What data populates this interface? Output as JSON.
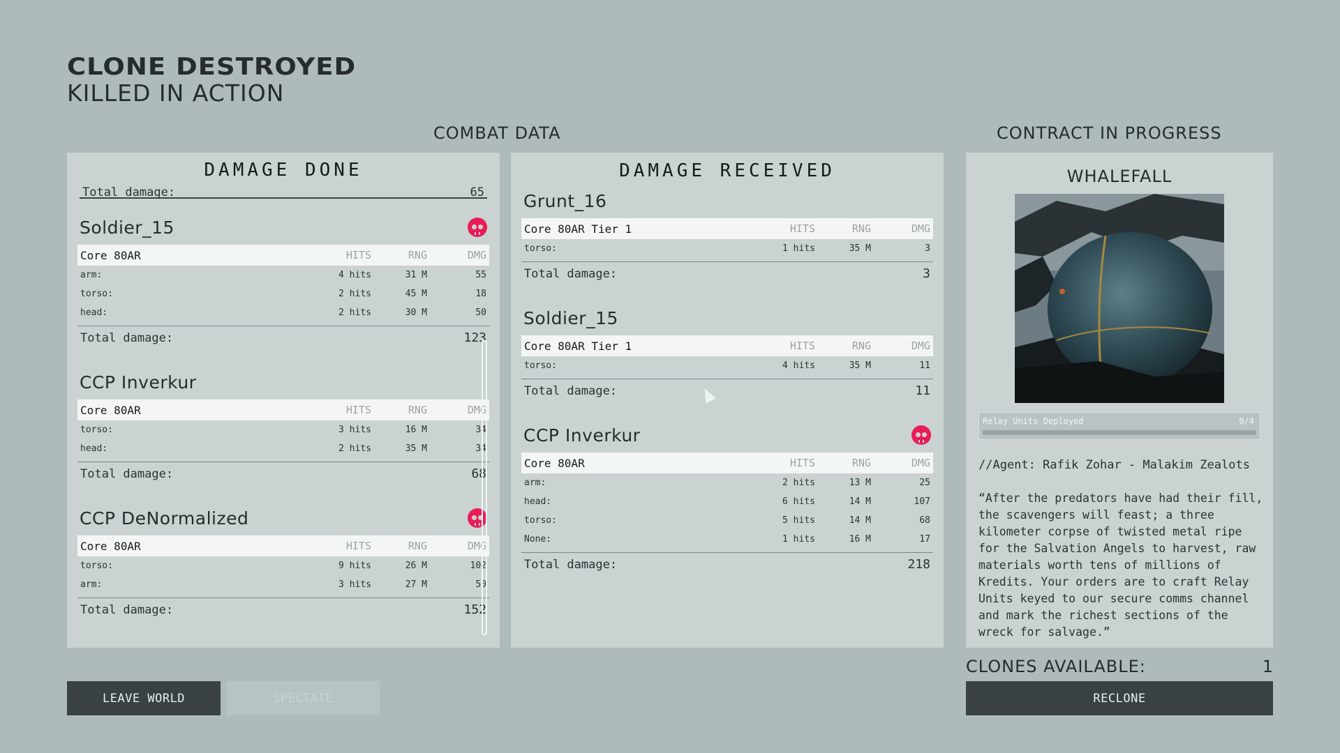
{
  "header": {
    "title": "CLONE DESTROYED",
    "subtitle": "KILLED IN ACTION"
  },
  "sections": {
    "combat_data": "COMBAT DATA",
    "contract": "CONTRACT IN PROGRESS"
  },
  "columns": {
    "hits": "HITS",
    "rng": "RNG",
    "dmg": "DMG"
  },
  "total_label": "Total damage:",
  "damage_done": {
    "title": "DAMAGE DONE",
    "cut_total": {
      "label": "Total damage:",
      "value": "65"
    },
    "entries": [
      {
        "name": "Soldier_15",
        "killed": true,
        "weapon": "Core 80AR",
        "rows": [
          {
            "part": "arm:",
            "hits": "4 hits",
            "rng": "31 M",
            "dmg": "55"
          },
          {
            "part": "torso:",
            "hits": "2 hits",
            "rng": "45 M",
            "dmg": "18"
          },
          {
            "part": "head:",
            "hits": "2 hits",
            "rng": "30 M",
            "dmg": "50"
          }
        ],
        "total": "123"
      },
      {
        "name": "CCP Inverkur",
        "killed": false,
        "weapon": "Core 80AR",
        "rows": [
          {
            "part": "torso:",
            "hits": "3 hits",
            "rng": "16 M",
            "dmg": "34"
          },
          {
            "part": "head:",
            "hits": "2 hits",
            "rng": "35 M",
            "dmg": "34"
          }
        ],
        "total": "68"
      },
      {
        "name": "CCP DeNormalized",
        "killed": true,
        "weapon": "Core 80AR",
        "rows": [
          {
            "part": "torso:",
            "hits": "9 hits",
            "rng": "26 M",
            "dmg": "102"
          },
          {
            "part": "arm:",
            "hits": "3 hits",
            "rng": "27 M",
            "dmg": "50"
          }
        ],
        "total": "152"
      }
    ]
  },
  "damage_received": {
    "title": "DAMAGE RECEIVED",
    "entries": [
      {
        "name": "Grunt_16",
        "killed": false,
        "weapon": "Core 80AR Tier 1",
        "rows": [
          {
            "part": "torso:",
            "hits": "1 hits",
            "rng": "35 M",
            "dmg": "3"
          }
        ],
        "total": "3"
      },
      {
        "name": "Soldier_15",
        "killed": false,
        "weapon": "Core 80AR Tier 1",
        "rows": [
          {
            "part": "torso:",
            "hits": "4 hits",
            "rng": "35 M",
            "dmg": "11"
          }
        ],
        "total": "11"
      },
      {
        "name": "CCP Inverkur",
        "killed": true,
        "weapon": "Core 80AR",
        "rows": [
          {
            "part": "arm:",
            "hits": "2 hits",
            "rng": "13 M",
            "dmg": "25"
          },
          {
            "part": "head:",
            "hits": "6 hits",
            "rng": "14 M",
            "dmg": "107"
          },
          {
            "part": "torso:",
            "hits": "5 hits",
            "rng": "14 M",
            "dmg": "68"
          },
          {
            "part": "None:",
            "hits": "1 hits",
            "rng": "16 M",
            "dmg": "17"
          }
        ],
        "total": "218"
      }
    ]
  },
  "contract": {
    "name": "WHALEFALL",
    "progress_label": "Relay Units Deployed",
    "progress_count": "0/4",
    "progress_fraction": 0,
    "agent": "//Agent: Rafik Zohar - Malakim Zealots",
    "quote": "“After the predators have had their fill, the scavengers will feast; a three kilometer corpse of twisted metal ripe for the Salvation Angels to harvest, raw materials worth tens of millions of Kredits. Your orders are to craft Relay Units keyed to our secure comms channel and mark the richest sections of the wreck for salvage.”"
  },
  "clones": {
    "label": "CLONES AVAILABLE:",
    "count": "1"
  },
  "buttons": {
    "leave": "LEAVE WORLD",
    "spectate": "SPECTATE",
    "reclone": "RECLONE"
  },
  "colors": {
    "background": "#aebbba",
    "panel": "#cad3d2",
    "kill_skull": "#e81d57",
    "button_dark": "#394142"
  },
  "icons": {
    "kill": "skull-icon",
    "cursor": "cursor-icon"
  }
}
